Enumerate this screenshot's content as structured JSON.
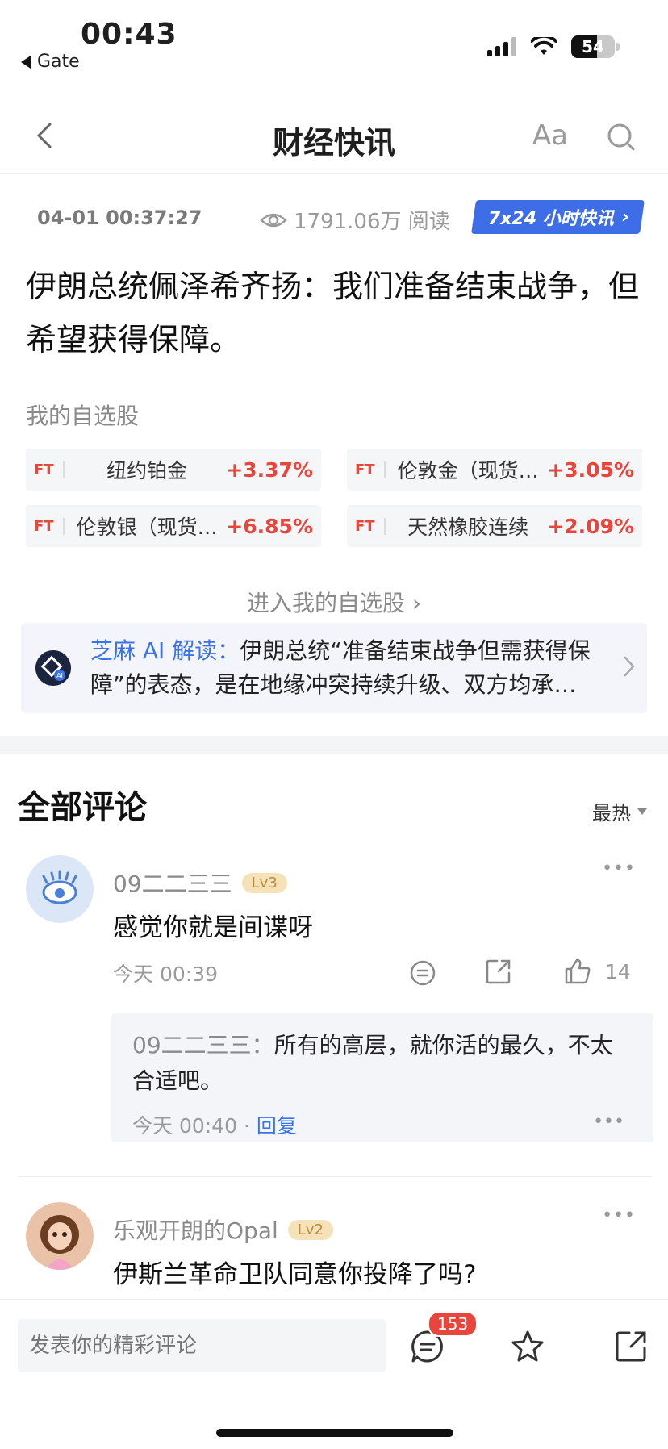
{
  "status_bar": {
    "time": "00:43",
    "back_app": "Gate",
    "battery": "54"
  },
  "nav": {
    "title": "财经快讯",
    "font_size_button": "Aa"
  },
  "meta": {
    "timestamp": "04-01 00:37:27",
    "views": "1791.06万 阅读",
    "badge": "7x24 小时快讯"
  },
  "headline": "伊朗总统佩泽希齐扬：我们准备结束战争，但希望获得保障。",
  "watchlist": {
    "title": "我的自选股",
    "items": [
      {
        "tag": "FT",
        "name": "纽约铂金",
        "change": "+3.37%"
      },
      {
        "tag": "FT",
        "name": "伦敦金（现货…",
        "change": "+3.05%"
      },
      {
        "tag": "FT",
        "name": "伦敦银（现货…",
        "change": "+6.85%"
      },
      {
        "tag": "FT",
        "name": "天然橡胶连续",
        "change": "+2.09%"
      }
    ],
    "enter_link": "进入我的自选股"
  },
  "ai": {
    "label": "芝麻 AI 解读：",
    "text": "伊朗总统“准备结束战争但需获得保障”的表态，是在地缘冲突持续升级、双方均承…"
  },
  "comments_section": {
    "title": "全部评论",
    "sort": "最热"
  },
  "comments": [
    {
      "user": "09二二三三",
      "level": "Lv3",
      "text": "感觉你就是间谍呀",
      "time": "今天 00:39",
      "likes": "14",
      "reply": {
        "user": "09二二三三：",
        "text": "所有的高层，就你活的最久，不太合适吧。",
        "time": "今天 00:40",
        "reply_label": "回复"
      }
    },
    {
      "user": "乐观开朗的Opal",
      "level": "Lv2",
      "text": "伊斯兰革命卫队同意你投降了吗?"
    }
  ],
  "bottom": {
    "input_placeholder": "发表你的精彩评论",
    "comment_count": "153"
  },
  "colors": {
    "accent": "#3a73e8",
    "up": "#e8453c"
  }
}
